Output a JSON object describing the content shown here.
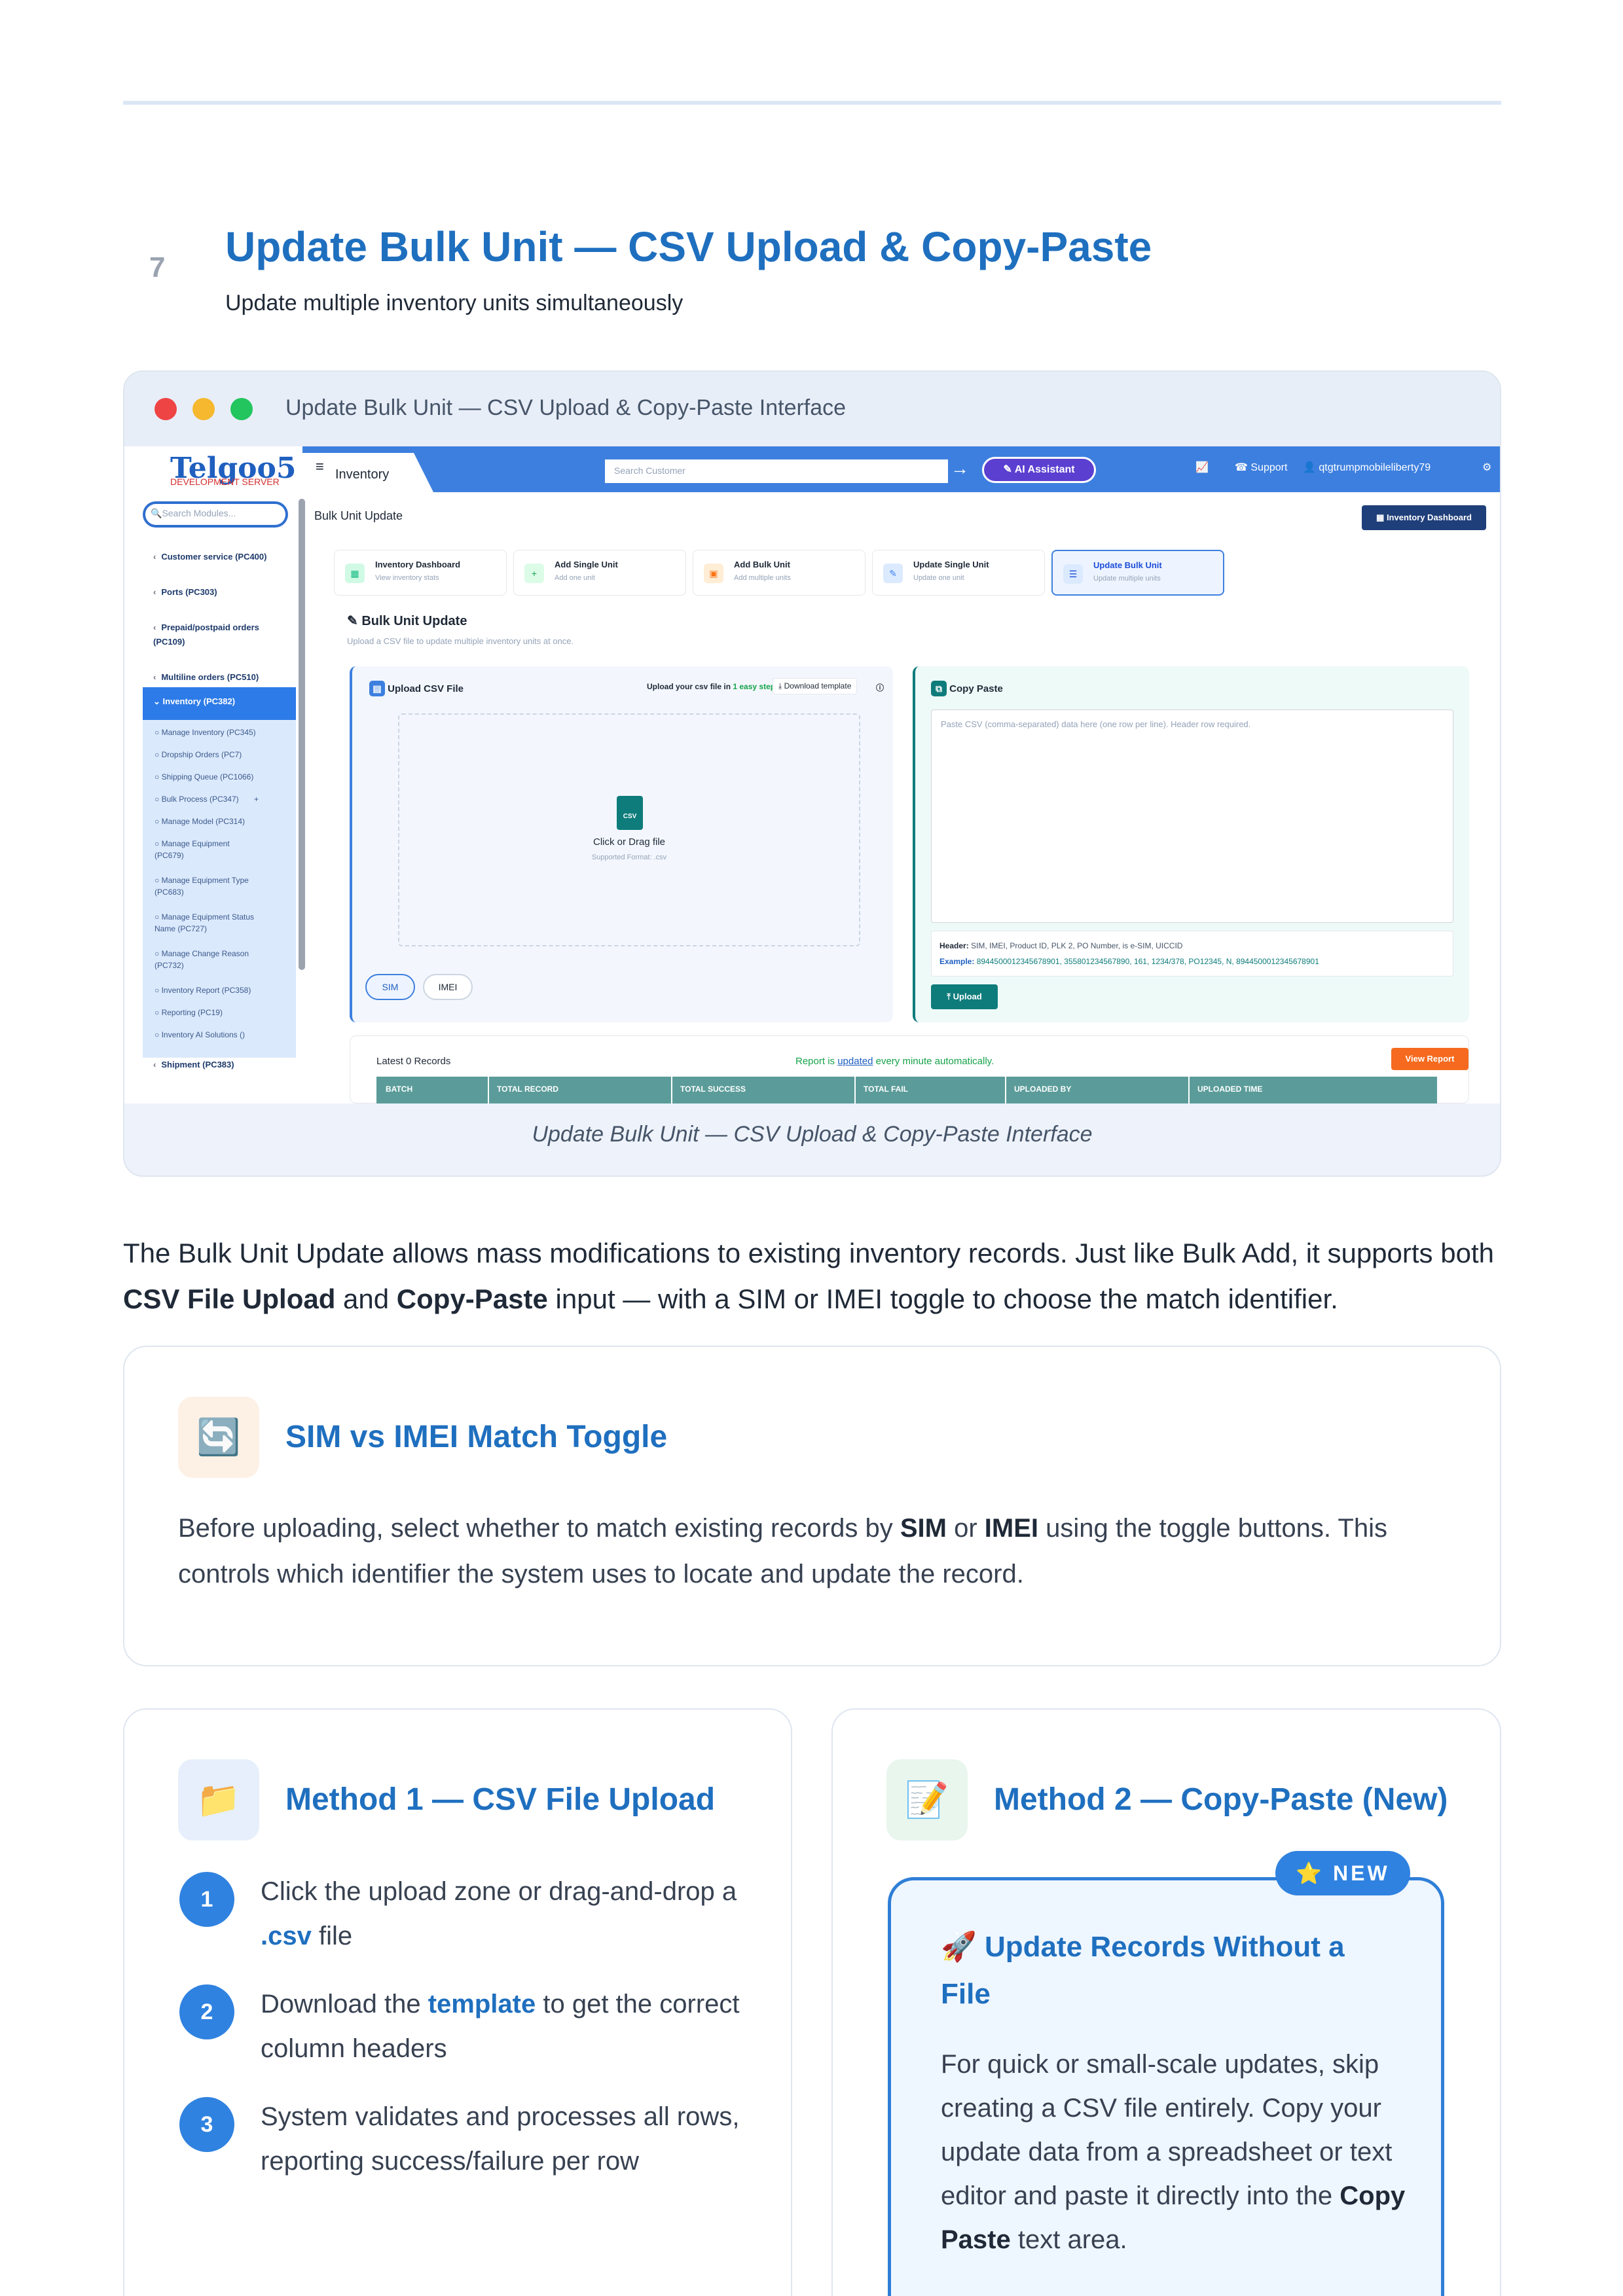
{
  "section": {
    "number": "7",
    "title": "Update Bulk Unit — CSV Upload & Copy-Paste",
    "subtitle": "Update multiple inventory units simultaneously"
  },
  "screenshot": {
    "window_title": "Update Bulk Unit — CSV Upload & Copy-Paste Interface",
    "caption": "Update Bulk Unit — CSV Upload & Copy-Paste Interface",
    "window_dots": [
      "#ef4444",
      "#f5b82e",
      "#22c55e"
    ],
    "app": {
      "logo": "Telgoo5",
      "logo_sub": "DEVELOPMENT SERVER",
      "search_modules_placeholder": "Search Modules...",
      "nav": [
        {
          "label": "Customer service (PC400)"
        },
        {
          "label": "Ports (PC303)"
        },
        {
          "label": "Prepaid/postpaid orders (PC109)"
        },
        {
          "label": "Multiline orders (PC510)"
        }
      ],
      "nav_active": "Inventory (PC382)",
      "nav_sub": [
        "Manage Inventory (PC345)",
        "Dropship Orders (PC7)",
        "Shipping Queue (PC1066)",
        "Bulk Process (PC347)",
        "Manage Model (PC314)",
        "Manage Equipment (PC679)",
        "Manage Equipment Type (PC683)",
        "Manage Equipment Status Name (PC727)",
        "Manage Change Reason (PC732)",
        "Inventory Report (PC358)",
        "Reporting (PC19)",
        "Inventory AI Solutions ()"
      ],
      "nav_last": "Shipment (PC383)",
      "module_tab": "Inventory",
      "search_customer_placeholder": "Search Customer",
      "ai_button": "AI Assistant",
      "support": "Support",
      "user": "qtgtrumpmobileliberty79",
      "breadcrumb": "Bulk Unit Update",
      "inventory_dashboard_btn": "Inventory Dashboard",
      "cards": [
        {
          "title": "Inventory Dashboard",
          "sub": "View inventory stats",
          "icon": "grid-icon",
          "color": "#10b981"
        },
        {
          "title": "Add Single Unit",
          "sub": "Add one unit",
          "icon": "plus-icon",
          "color": "#16a34a"
        },
        {
          "title": "Add Bulk Unit",
          "sub": "Add multiple units",
          "icon": "boxes-icon",
          "color": "#f97316"
        },
        {
          "title": "Update Single Unit",
          "sub": "Update one unit",
          "icon": "pencil-icon",
          "color": "#3b82f6"
        },
        {
          "title": "Update Bulk Unit",
          "sub": "Update multiple units",
          "icon": "list-icon",
          "color": "#1d4ed8"
        }
      ],
      "bulk_title": "Bulk Unit Update",
      "bulk_sub": "Upload a CSV file to update multiple inventory units at once.",
      "upload": {
        "title": "Upload CSV File",
        "steps_text": "Upload your csv file in",
        "steps_highlight": "1 easy step!",
        "download_template": "Download template",
        "dropzone_title": "Click or Drag file",
        "dropzone_sub": "Supported Format: .csv",
        "csv_badge": "CSV",
        "toggle_sim": "SIM",
        "toggle_imei": "IMEI"
      },
      "copy_paste": {
        "title": "Copy Paste",
        "placeholder": "Paste CSV (comma-separated) data here (one row per line). Header row required.",
        "header_label": "Header:",
        "header_value": "SIM, IMEI, Product ID, PLK 2, PO Number, is e-SIM, UICCID",
        "example_label": "Example:",
        "example_value": "8944500012345678901, 355801234567890, 161, 1234/378, PO12345, N, 8944500012345678901",
        "upload_btn": "Upload"
      },
      "records": {
        "latest": "Latest 0 Records",
        "note_prefix": "Report is",
        "note_link": "updated",
        "note_suffix": "every minute automatically.",
        "view_report": "View Report",
        "columns": [
          "BATCH",
          "TOTAL RECORD",
          "TOTAL SUCCESS",
          "TOTAL FAIL",
          "UPLOADED BY",
          "UPLOADED TIME"
        ]
      }
    }
  },
  "intro": {
    "p1": "The Bulk Unit Update allows mass modifications to existing inventory records. Just like Bulk Add, it supports both",
    "b1": "CSV File Upload",
    "p2": "and",
    "b2": "Copy-Paste",
    "p3": "input — with a SIM or IMEI toggle to choose the match identifier."
  },
  "toggle_card": {
    "icon": "refresh-icon",
    "title": "SIM vs IMEI Match Toggle",
    "t1": "Before uploading, select whether to match existing records by",
    "b1": "SIM",
    "t2": "or",
    "b2": "IMEI",
    "t3": "using the toggle buttons. This controls which identifier the system uses to locate and update the record."
  },
  "method1": {
    "icon": "folder-icon",
    "title": "Method 1 — CSV File Upload",
    "steps": [
      {
        "num": "1",
        "pre": "Click the upload zone or drag-and-drop a",
        "hl": ".csv",
        "post": "file"
      },
      {
        "num": "2",
        "pre": "Download the",
        "hl": "template",
        "post": "to get the correct column headers"
      },
      {
        "num": "3",
        "pre": "System validates and processes all rows, reporting success/failure per row",
        "hl": "",
        "post": ""
      }
    ]
  },
  "method2": {
    "icon": "memo-icon",
    "title": "Method 2 — Copy-Paste (New)",
    "badge": "NEW",
    "box_title": "Update Records Without a File",
    "t1": "For quick or small-scale updates, skip creating a CSV file entirely. Copy your update data from a spreadsheet or text editor and paste it directly into the",
    "b1": "Copy Paste",
    "t2": "text area."
  }
}
